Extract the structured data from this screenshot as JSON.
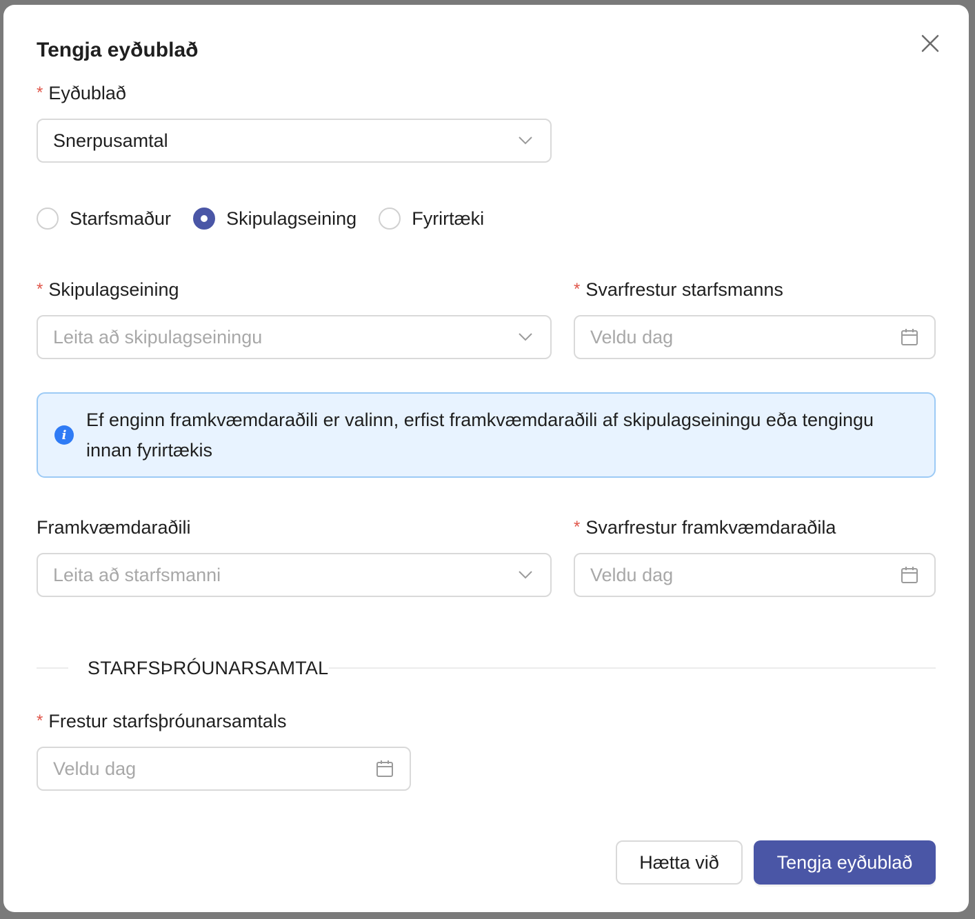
{
  "modal": {
    "title": "Tengja eyðublað",
    "close_icon": "close-icon"
  },
  "form_select": {
    "label": "Eyðublað",
    "value": "Snerpusamtal",
    "required": true
  },
  "assignment_type": {
    "options": [
      {
        "label": "Starfsmaður",
        "checked": false
      },
      {
        "label": "Skipulagseining",
        "checked": true
      },
      {
        "label": "Fyrirtæki",
        "checked": false
      }
    ]
  },
  "org_unit": {
    "label": "Skipulagseining",
    "placeholder": "Leita að skipulagseiningu",
    "required": true
  },
  "employee_deadline": {
    "label": "Svarfrestur starfsmanns",
    "placeholder": "Veldu dag",
    "required": true
  },
  "info_alert": {
    "text": "Ef enginn framkvæmdaraðili er valinn, erfist framkvæmdaraðili af skipulagseiningu eða tengingu innan fyrirtækis",
    "icon": "info-icon",
    "color": "#2f7bf5"
  },
  "executor": {
    "label": "Framkvæmdaraðili",
    "placeholder": "Leita að starfsmanni",
    "required": false
  },
  "executor_deadline": {
    "label": "Svarfrestur framkvæmdaraðila",
    "placeholder": "Veldu dag",
    "required": true
  },
  "section": {
    "title": "STARFSÞRÓUNARSAMTAL"
  },
  "development_deadline": {
    "label": "Frestur starfsþróunarsamtals",
    "placeholder": "Veldu dag",
    "required": true
  },
  "footer": {
    "cancel_label": "Hætta við",
    "submit_label": "Tengja eyðublað"
  },
  "colors": {
    "primary": "#4a56a6",
    "required_marker": "#e0564a",
    "info_bg": "#e8f3ff",
    "info_border": "#9ccaf5"
  }
}
